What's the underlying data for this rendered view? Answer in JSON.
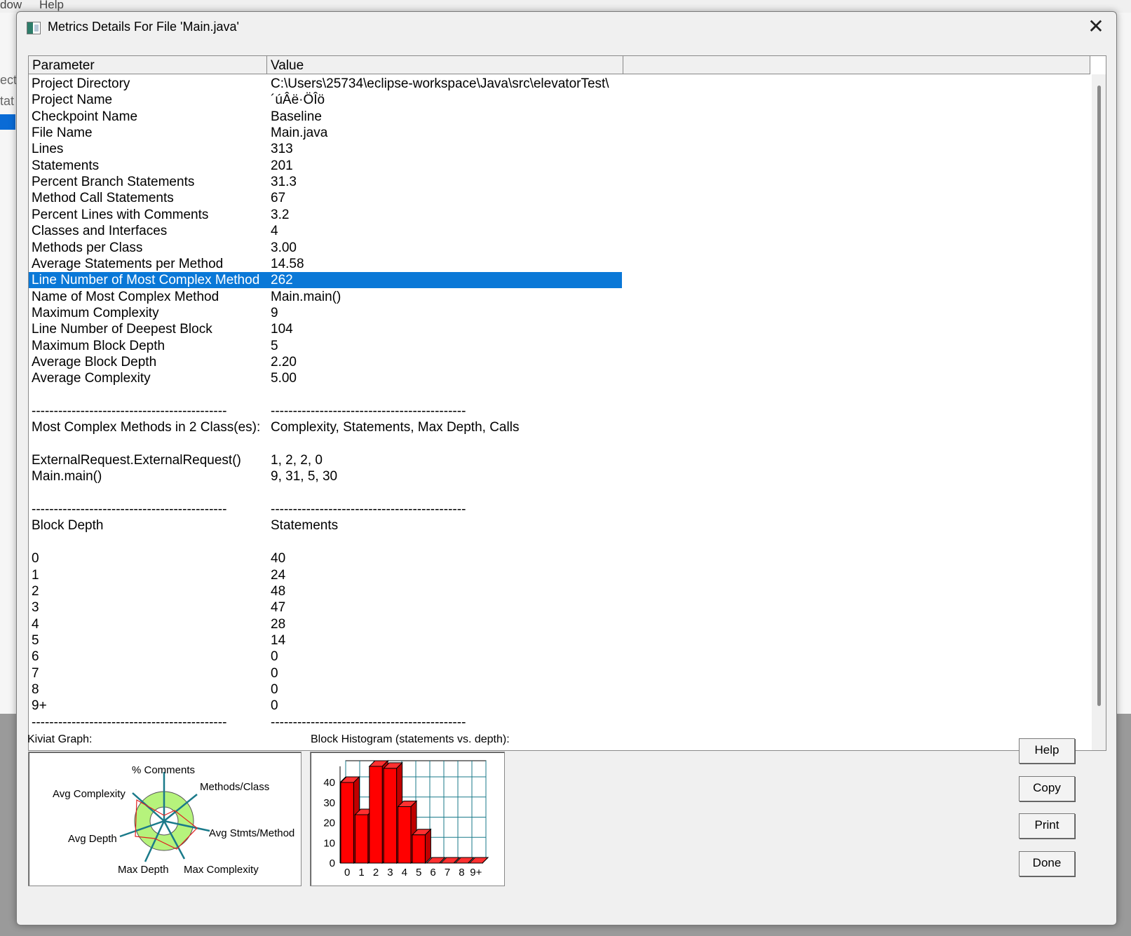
{
  "background_app": {
    "menu": [
      "dow",
      "Help"
    ],
    "side_labels": [
      "ect",
      "tat"
    ]
  },
  "dialog": {
    "title": "Metrics Details For File 'Main.java'"
  },
  "table": {
    "columns": [
      "Parameter",
      "Value"
    ],
    "selected_row_index": 12,
    "rows": [
      {
        "p": "Project Directory",
        "v": "C:\\Users\\25734\\eclipse-workspace\\Java\\src\\elevatorTest\\"
      },
      {
        "p": "Project Name",
        "v": "´úÂë·ÖÎö"
      },
      {
        "p": "Checkpoint Name",
        "v": "Baseline"
      },
      {
        "p": "File Name",
        "v": "Main.java"
      },
      {
        "p": "Lines",
        "v": "313"
      },
      {
        "p": "Statements",
        "v": "201"
      },
      {
        "p": "Percent Branch Statements",
        "v": "31.3"
      },
      {
        "p": "Method Call Statements",
        "v": "67"
      },
      {
        "p": "Percent Lines with Comments",
        "v": "3.2"
      },
      {
        "p": "Classes and Interfaces",
        "v": "4"
      },
      {
        "p": "Methods per Class",
        "v": "3.00"
      },
      {
        "p": "Average Statements per Method",
        "v": "14.58"
      },
      {
        "p": "Line Number of Most Complex Method",
        "v": "262"
      },
      {
        "p": "Name of Most Complex Method",
        "v": "Main.main()"
      },
      {
        "p": "Maximum Complexity",
        "v": "9"
      },
      {
        "p": "Line Number of Deepest Block",
        "v": "104"
      },
      {
        "p": "Maximum Block Depth",
        "v": "5"
      },
      {
        "p": "Average Block Depth",
        "v": "2.20"
      },
      {
        "p": "Average Complexity",
        "v": "5.00"
      },
      {
        "p": "",
        "v": ""
      },
      {
        "p": "--------------------------------------------",
        "v": "--------------------------------------------"
      },
      {
        "p": "Most Complex Methods in 2 Class(es):",
        "v": "Complexity, Statements, Max Depth, Calls"
      },
      {
        "p": "",
        "v": ""
      },
      {
        "p": "ExternalRequest.ExternalRequest()",
        "v": "1, 2, 2, 0"
      },
      {
        "p": "Main.main()",
        "v": "9, 31, 5, 30"
      },
      {
        "p": "",
        "v": ""
      },
      {
        "p": "--------------------------------------------",
        "v": "--------------------------------------------"
      },
      {
        "p": "Block Depth",
        "v": "Statements"
      },
      {
        "p": "",
        "v": ""
      },
      {
        "p": "0",
        "v": "40"
      },
      {
        "p": "1",
        "v": "24"
      },
      {
        "p": "2",
        "v": "48"
      },
      {
        "p": "3",
        "v": "47"
      },
      {
        "p": "4",
        "v": "28"
      },
      {
        "p": "5",
        "v": "14"
      },
      {
        "p": "6",
        "v": "0"
      },
      {
        "p": "7",
        "v": "0"
      },
      {
        "p": "8",
        "v": "0"
      },
      {
        "p": "9+",
        "v": "0"
      },
      {
        "p": "--------------------------------------------",
        "v": "--------------------------------------------"
      }
    ]
  },
  "kiviat": {
    "label": "Kiviat Graph:",
    "axes": [
      "% Comments",
      "Methods/Class",
      "Avg Stmts/Method",
      "Max Complexity",
      "Max Depth",
      "Avg Depth",
      "Avg Complexity"
    ]
  },
  "histogram": {
    "label": "Block Histogram (statements vs. depth):"
  },
  "chart_data": {
    "type": "bar",
    "categories": [
      "0",
      "1",
      "2",
      "3",
      "4",
      "5",
      "6",
      "7",
      "8",
      "9+"
    ],
    "values": [
      40,
      24,
      48,
      47,
      28,
      14,
      0,
      0,
      0,
      0
    ],
    "yticks": [
      "0",
      "10",
      "20",
      "30",
      "40"
    ],
    "ylim": [
      0,
      48
    ],
    "grid": true,
    "bar_color": "#ff0000"
  },
  "buttons": {
    "help": "Help",
    "copy": "Copy",
    "print": "Print",
    "done": "Done"
  },
  "colors": {
    "selection": "#0a78d7",
    "kiviat_ring": "#b6f37c",
    "kiviat_spokes": "#1a7a8a",
    "grid": "#1a7a8a"
  }
}
